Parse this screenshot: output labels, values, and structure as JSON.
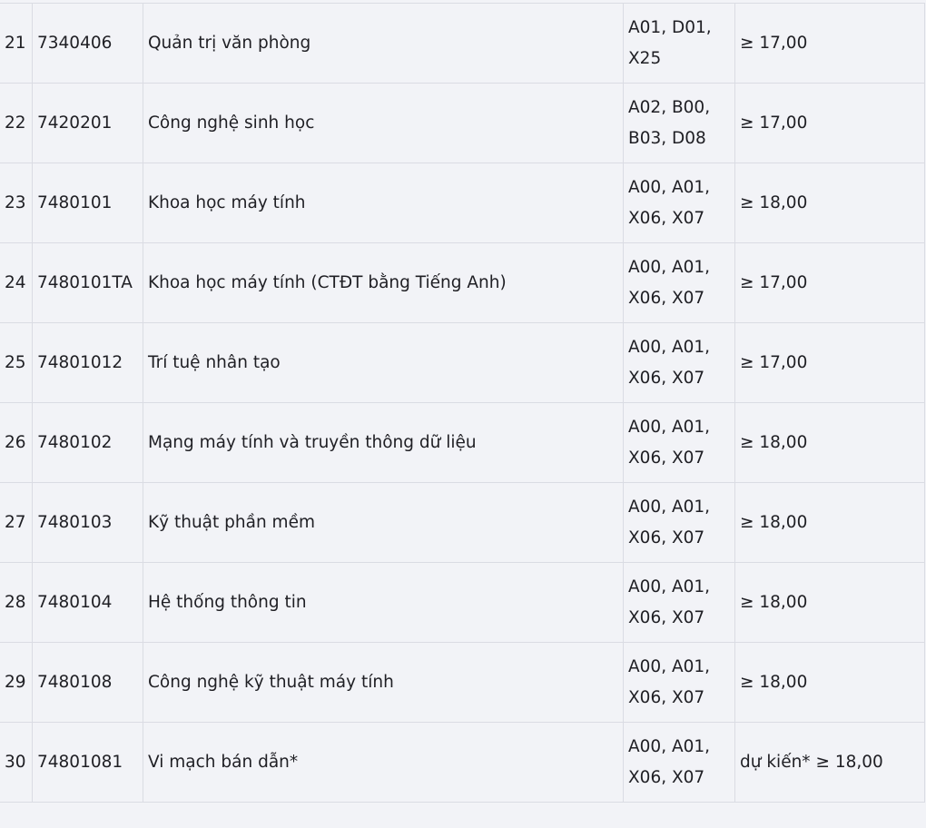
{
  "rows": [
    {
      "stt": "21",
      "code": "7340406",
      "name": "Quản trị văn phòng",
      "combo_line1": "A01, D01,",
      "combo_line2": "X25",
      "score": "≥ 17,00"
    },
    {
      "stt": "22",
      "code": "7420201",
      "name": "Công nghệ sinh học",
      "combo_line1": "A02, B00,",
      "combo_line2": "B03, D08",
      "score": "≥ 17,00"
    },
    {
      "stt": "23",
      "code": "7480101",
      "name": "Khoa học máy tính",
      "combo_line1": "A00, A01,",
      "combo_line2": "X06, X07",
      "score": "≥ 18,00"
    },
    {
      "stt": "24",
      "code": "7480101TA",
      "name": "Khoa học máy tính (CTĐT bằng Tiếng Anh)",
      "combo_line1": "A00, A01,",
      "combo_line2": "X06, X07",
      "score": "≥ 17,00"
    },
    {
      "stt": "25",
      "code": "74801012",
      "name": "Trí tuệ nhân tạo",
      "combo_line1": "A00, A01,",
      "combo_line2": "X06, X07",
      "score": "≥ 17,00"
    },
    {
      "stt": "26",
      "code": "7480102",
      "name": "Mạng máy tính và truyền thông dữ liệu",
      "combo_line1": "A00, A01,",
      "combo_line2": "X06, X07",
      "score": "≥ 18,00"
    },
    {
      "stt": "27",
      "code": "7480103",
      "name": "Kỹ thuật phần mềm",
      "combo_line1": "A00, A01,",
      "combo_line2": "X06, X07",
      "score": "≥ 18,00"
    },
    {
      "stt": "28",
      "code": "7480104",
      "name": "Hệ thống thông tin",
      "combo_line1": "A00, A01,",
      "combo_line2": "X06, X07",
      "score": "≥ 18,00"
    },
    {
      "stt": "29",
      "code": "7480108",
      "name": "Công nghệ kỹ thuật máy tính",
      "combo_line1": "A00, A01,",
      "combo_line2": "X06, X07",
      "score": "≥ 18,00"
    },
    {
      "stt": "30",
      "code": "74801081",
      "name": "Vi mạch bán dẫn*",
      "combo_line1": "A00, A01,",
      "combo_line2": "X06, X07",
      "score": "dự kiến* ≥ 18,00"
    }
  ]
}
